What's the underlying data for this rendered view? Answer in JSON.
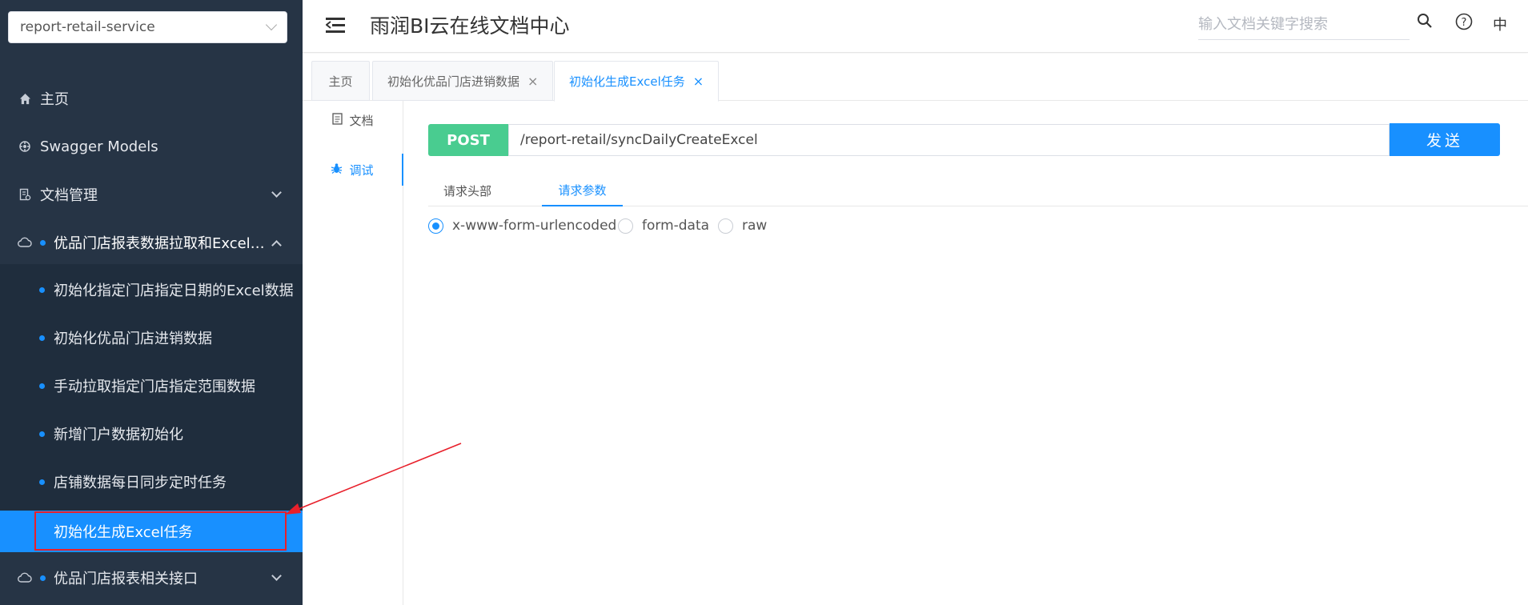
{
  "sidebar": {
    "service_select": "report-retail-service",
    "menu": [
      {
        "label": "主页",
        "icon": "home-icon"
      },
      {
        "label": "Swagger Models",
        "icon": "models-icon"
      },
      {
        "label": "文档管理",
        "icon": "document-manage-icon"
      },
      {
        "label": "优品门店报表数据拉取和Excel…",
        "icon": "cloud-icon"
      },
      {
        "label": "优品门店报表相关接口",
        "icon": "cloud-icon"
      }
    ],
    "submenu": [
      {
        "label": "初始化指定门店指定日期的Excel数据"
      },
      {
        "label": "初始化优品门店进销数据"
      },
      {
        "label": "手动拉取指定门店指定范围数据"
      },
      {
        "label": "新增门户数据初始化"
      },
      {
        "label": "店铺数据每日同步定时任务"
      },
      {
        "label": "初始化生成Excel任务",
        "active": true
      }
    ]
  },
  "header": {
    "title": "雨润BI云在线文档中心",
    "search_placeholder": "输入文档关键字搜索",
    "lang": "中",
    "help_icon": "?"
  },
  "tabs": [
    {
      "label": "主页",
      "closable": false
    },
    {
      "label": "初始化优品门店进销数据",
      "closable": true
    },
    {
      "label": "初始化生成Excel任务",
      "closable": true,
      "active": true
    }
  ],
  "tab_close_glyph": "×",
  "docnav": [
    {
      "label": "文档",
      "icon": "document-icon"
    },
    {
      "label": "调试",
      "icon": "bug-icon",
      "active": true
    }
  ],
  "request": {
    "method": "POST",
    "url": "/report-retail/syncDailyCreateExcel",
    "send_label": "发送"
  },
  "subtabs": [
    {
      "label": "请求头部"
    },
    {
      "label": "请求参数",
      "active": true
    }
  ],
  "body_types": [
    {
      "label": "x-www-form-urlencoded",
      "checked": true
    },
    {
      "label": "form-data",
      "checked": false
    },
    {
      "label": "raw",
      "checked": false
    }
  ],
  "colors": {
    "sidebar_bg": "#263445",
    "submenu_bg": "#1f2d3d",
    "accent": "#1890ff",
    "post_green": "#49cc90",
    "annotation_red": "#e8202b"
  }
}
